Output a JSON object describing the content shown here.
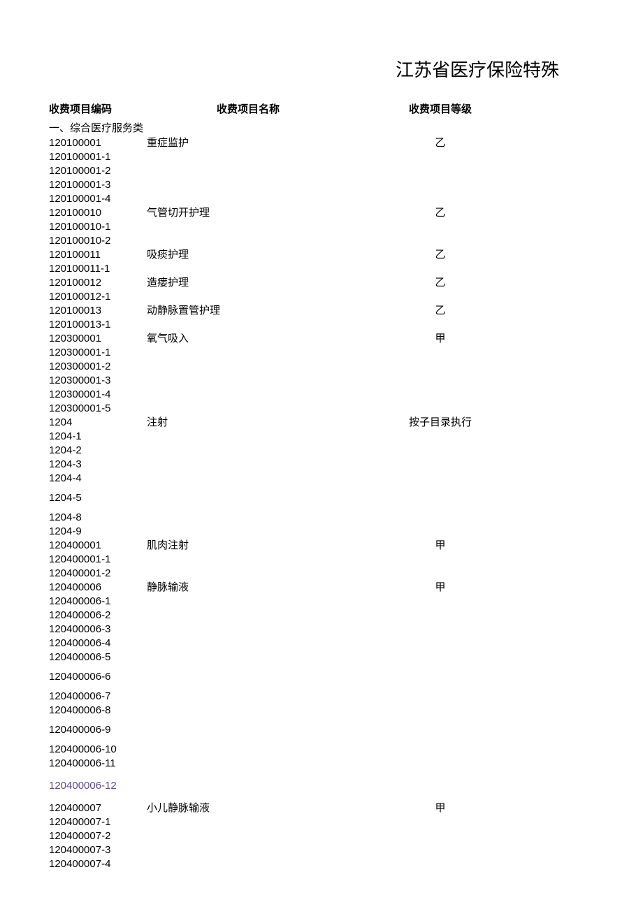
{
  "title": "江苏省医疗保险特殊",
  "headers": {
    "code": "收费项目编码",
    "name": "收费项目名称",
    "grade": "收费项目等级"
  },
  "section1": "一、综合医疗服务类",
  "rows": [
    {
      "code": "120100001",
      "name": "重症监护",
      "grade": "乙"
    },
    {
      "code": "120100001-1",
      "name": "",
      "grade": ""
    },
    {
      "code": "120100001-2",
      "name": "",
      "grade": ""
    },
    {
      "code": "120100001-3",
      "name": "",
      "grade": ""
    },
    {
      "code": "120100001-4",
      "name": "",
      "grade": ""
    },
    {
      "code": "120100010",
      "name": "气管切开护理",
      "grade": "乙"
    },
    {
      "code": "120100010-1",
      "name": "",
      "grade": ""
    },
    {
      "code": "120100010-2",
      "name": "",
      "grade": ""
    },
    {
      "code": "120100011",
      "name": "吸痰护理",
      "grade": "乙"
    },
    {
      "code": "120100011-1",
      "name": "",
      "grade": ""
    },
    {
      "code": "120100012",
      "name": "造瘘护理",
      "grade": "乙"
    },
    {
      "code": "120100012-1",
      "name": "",
      "grade": ""
    },
    {
      "code": "120100013",
      "name": "动静脉置管护理",
      "grade": "乙"
    },
    {
      "code": "120100013-1",
      "name": "",
      "grade": ""
    },
    {
      "code": "120300001",
      "name": "氧气吸入",
      "grade": "甲"
    },
    {
      "code": "120300001-1",
      "name": "",
      "grade": ""
    },
    {
      "code": "120300001-2",
      "name": "",
      "grade": ""
    },
    {
      "code": "120300001-3",
      "name": "",
      "grade": ""
    },
    {
      "code": "120300001-4",
      "name": "",
      "grade": ""
    },
    {
      "code": "120300001-5",
      "name": "",
      "grade": ""
    },
    {
      "code": "1204",
      "name": "注射",
      "grade": "按子目录执行"
    },
    {
      "code": "1204-1",
      "name": "",
      "grade": ""
    },
    {
      "code": "1204-2",
      "name": "",
      "grade": ""
    },
    {
      "code": "1204-3",
      "name": "",
      "grade": ""
    },
    {
      "code": "1204-4",
      "name": "",
      "grade": ""
    }
  ],
  "rows_b": [
    {
      "code": "1204-5",
      "name": "",
      "grade": ""
    }
  ],
  "rows_c": [
    {
      "code": "1204-8",
      "name": "",
      "grade": ""
    },
    {
      "code": "1204-9",
      "name": "",
      "grade": ""
    },
    {
      "code": "120400001",
      "name": "肌肉注射",
      "grade": "甲"
    },
    {
      "code": "120400001-1",
      "name": "",
      "grade": ""
    },
    {
      "code": "120400001-2",
      "name": "",
      "grade": ""
    },
    {
      "code": "120400006",
      "name": "静脉输液",
      "grade": "甲"
    },
    {
      "code": "120400006-1",
      "name": "",
      "grade": ""
    },
    {
      "code": "120400006-2",
      "name": "",
      "grade": ""
    },
    {
      "code": "120400006-3",
      "name": "",
      "grade": ""
    },
    {
      "code": "120400006-4",
      "name": "",
      "grade": ""
    },
    {
      "code": "120400006-5",
      "name": "",
      "grade": ""
    }
  ],
  "rows_d": [
    {
      "code": "120400006-6",
      "name": "",
      "grade": ""
    }
  ],
  "rows_e": [
    {
      "code": "120400006-7",
      "name": "",
      "grade": ""
    },
    {
      "code": "120400006-8",
      "name": "",
      "grade": ""
    }
  ],
  "rows_f": [
    {
      "code": "120400006-9",
      "name": "",
      "grade": ""
    }
  ],
  "rows_g": [
    {
      "code": "120400006-10",
      "name": "",
      "grade": ""
    },
    {
      "code": "120400006-11",
      "name": "",
      "grade": ""
    }
  ],
  "rows_h": [
    {
      "code": "120400006-12",
      "name": "",
      "grade": "",
      "purple": true
    }
  ],
  "rows_i": [
    {
      "code": "120400007",
      "name": "小儿静脉输液",
      "grade": "甲"
    },
    {
      "code": "120400007-1",
      "name": "",
      "grade": ""
    },
    {
      "code": "120400007-2",
      "name": "",
      "grade": ""
    },
    {
      "code": "120400007-3",
      "name": "",
      "grade": ""
    },
    {
      "code": "120400007-4",
      "name": "",
      "grade": ""
    }
  ]
}
